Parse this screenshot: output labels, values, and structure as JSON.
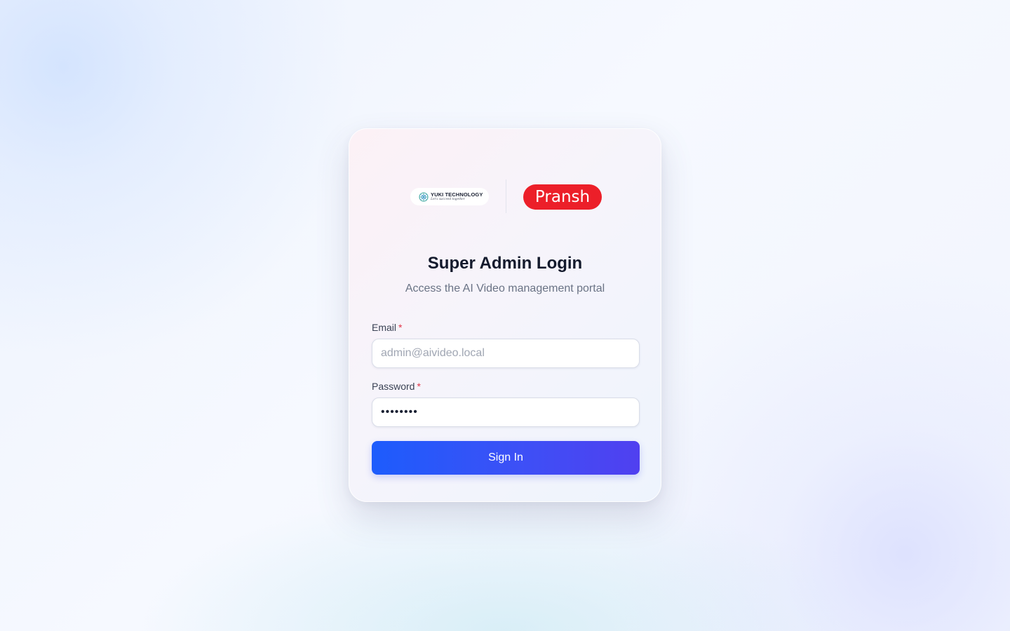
{
  "brand": {
    "yuki_name": "YUKI TECHNOLOGY",
    "yuki_tagline": "Let's succeed together",
    "pransh_name": "Pransh",
    "pransh_color": "#ec1f29"
  },
  "login": {
    "title": "Super Admin Login",
    "subtitle": "Access the AI Video management portal",
    "email_label": "Email",
    "email_placeholder": "admin@aivideo.local",
    "password_label": "Password",
    "password_value": "••••••••",
    "required_marker": "*",
    "submit_label": "Sign In"
  },
  "colors": {
    "button_gradient_start": "#1d5cfc",
    "button_gradient_end": "#5040f0",
    "required": "#e2374a"
  },
  "icons": {
    "yuki_mark": "globe-network-icon"
  }
}
